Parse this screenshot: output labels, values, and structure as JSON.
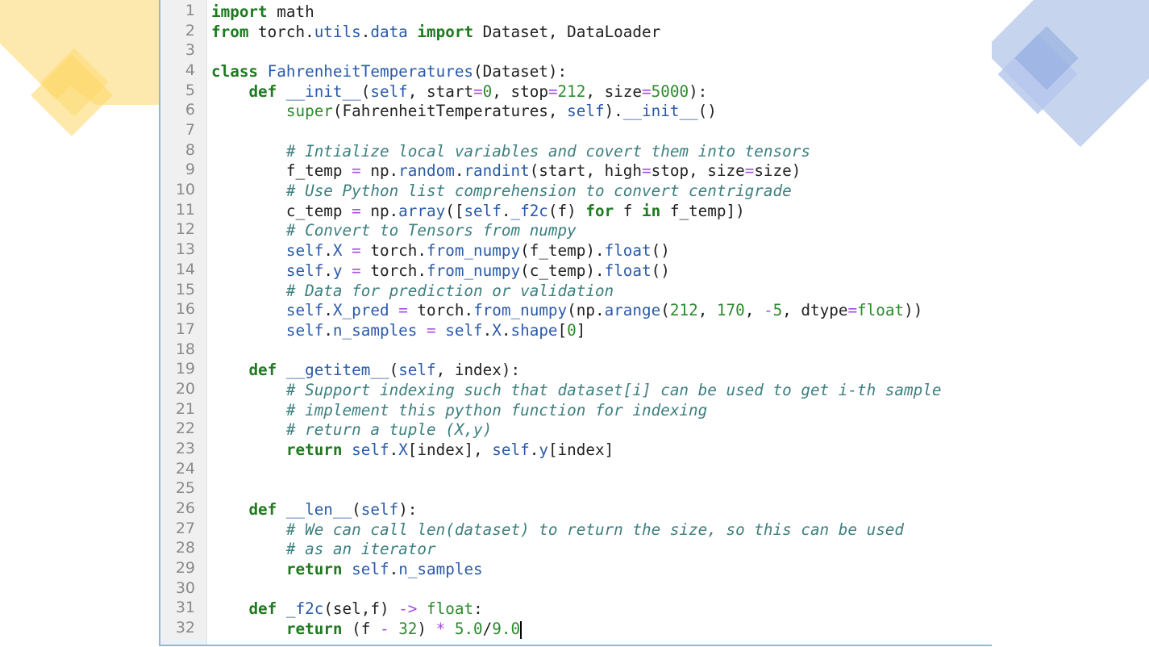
{
  "colors": {
    "keyword": "#1f7a1f",
    "name": "#2a5aa8",
    "number": "#2d8a2d",
    "operator": "#a64ce0",
    "comment": "#3d7f7f",
    "deco_yellow": "#fde7a8",
    "deco_blue": "#c5d3ee"
  },
  "editor": {
    "lines": [
      [
        [
          "k",
          "import"
        ],
        [
          "t",
          " math"
        ]
      ],
      [
        [
          "k",
          "from"
        ],
        [
          "t",
          " torch."
        ],
        [
          "n",
          "utils"
        ],
        [
          "t",
          "."
        ],
        [
          "n",
          "data"
        ],
        [
          "t",
          " "
        ],
        [
          "k",
          "import"
        ],
        [
          "t",
          " Dataset, DataLoader"
        ]
      ],
      [],
      [
        [
          "k",
          "class"
        ],
        [
          "t",
          " "
        ],
        [
          "n",
          "FahrenheitTemperatures"
        ],
        [
          "t",
          "(Dataset):"
        ]
      ],
      [
        [
          "t",
          "    "
        ],
        [
          "k",
          "def"
        ],
        [
          "t",
          " "
        ],
        [
          "n",
          "__init__"
        ],
        [
          "t",
          "("
        ],
        [
          "n",
          "self"
        ],
        [
          "t",
          ", start"
        ],
        [
          "o",
          "="
        ],
        [
          "m",
          "0"
        ],
        [
          "t",
          ", stop"
        ],
        [
          "o",
          "="
        ],
        [
          "m",
          "212"
        ],
        [
          "t",
          ", size"
        ],
        [
          "o",
          "="
        ],
        [
          "m",
          "5000"
        ],
        [
          "t",
          "):"
        ]
      ],
      [
        [
          "t",
          "        "
        ],
        [
          "b",
          "super"
        ],
        [
          "t",
          "(FahrenheitTemperatures, "
        ],
        [
          "n",
          "self"
        ],
        [
          "t",
          ")."
        ],
        [
          "n",
          "__init__"
        ],
        [
          "t",
          "()"
        ]
      ],
      [],
      [
        [
          "t",
          "        "
        ],
        [
          "c",
          "# Intialize local variables and covert them into tensors"
        ]
      ],
      [
        [
          "t",
          "        f_temp "
        ],
        [
          "o",
          "="
        ],
        [
          "t",
          " np."
        ],
        [
          "n",
          "random"
        ],
        [
          "t",
          "."
        ],
        [
          "n",
          "randint"
        ],
        [
          "t",
          "(start, high"
        ],
        [
          "o",
          "="
        ],
        [
          "t",
          "stop, size"
        ],
        [
          "o",
          "="
        ],
        [
          "t",
          "size)"
        ]
      ],
      [
        [
          "t",
          "        "
        ],
        [
          "c",
          "# Use Python list comprehension to convert centrigrade"
        ]
      ],
      [
        [
          "t",
          "        c_temp "
        ],
        [
          "o",
          "="
        ],
        [
          "t",
          " np."
        ],
        [
          "n",
          "array"
        ],
        [
          "t",
          "(["
        ],
        [
          "n",
          "self"
        ],
        [
          "t",
          "."
        ],
        [
          "n",
          "_f2c"
        ],
        [
          "t",
          "(f) "
        ],
        [
          "k",
          "for"
        ],
        [
          "t",
          " f "
        ],
        [
          "k",
          "in"
        ],
        [
          "t",
          " f_temp])"
        ]
      ],
      [
        [
          "t",
          "        "
        ],
        [
          "c",
          "# Convert to Tensors from numpy"
        ]
      ],
      [
        [
          "t",
          "        "
        ],
        [
          "n",
          "self"
        ],
        [
          "t",
          "."
        ],
        [
          "n",
          "X"
        ],
        [
          "t",
          " "
        ],
        [
          "o",
          "="
        ],
        [
          "t",
          " torch."
        ],
        [
          "n",
          "from_numpy"
        ],
        [
          "t",
          "(f_temp)."
        ],
        [
          "n",
          "float"
        ],
        [
          "t",
          "()"
        ]
      ],
      [
        [
          "t",
          "        "
        ],
        [
          "n",
          "self"
        ],
        [
          "t",
          "."
        ],
        [
          "n",
          "y"
        ],
        [
          "t",
          " "
        ],
        [
          "o",
          "="
        ],
        [
          "t",
          " torch."
        ],
        [
          "n",
          "from_numpy"
        ],
        [
          "t",
          "(c_temp)."
        ],
        [
          "n",
          "float"
        ],
        [
          "t",
          "()"
        ]
      ],
      [
        [
          "t",
          "        "
        ],
        [
          "c",
          "# Data for prediction or validation"
        ]
      ],
      [
        [
          "t",
          "        "
        ],
        [
          "n",
          "self"
        ],
        [
          "t",
          "."
        ],
        [
          "n",
          "X_pred"
        ],
        [
          "t",
          " "
        ],
        [
          "o",
          "="
        ],
        [
          "t",
          " torch."
        ],
        [
          "n",
          "from_numpy"
        ],
        [
          "t",
          "(np."
        ],
        [
          "n",
          "arange"
        ],
        [
          "t",
          "("
        ],
        [
          "m",
          "212"
        ],
        [
          "t",
          ", "
        ],
        [
          "m",
          "170"
        ],
        [
          "t",
          ", "
        ],
        [
          "o",
          "-"
        ],
        [
          "m",
          "5"
        ],
        [
          "t",
          ", dtype"
        ],
        [
          "o",
          "="
        ],
        [
          "b",
          "float"
        ],
        [
          "t",
          "))"
        ]
      ],
      [
        [
          "t",
          "        "
        ],
        [
          "n",
          "self"
        ],
        [
          "t",
          "."
        ],
        [
          "n",
          "n_samples"
        ],
        [
          "t",
          " "
        ],
        [
          "o",
          "="
        ],
        [
          "t",
          " "
        ],
        [
          "n",
          "self"
        ],
        [
          "t",
          "."
        ],
        [
          "n",
          "X"
        ],
        [
          "t",
          "."
        ],
        [
          "n",
          "shape"
        ],
        [
          "t",
          "["
        ],
        [
          "m",
          "0"
        ],
        [
          "t",
          "]"
        ]
      ],
      [],
      [
        [
          "t",
          "    "
        ],
        [
          "k",
          "def"
        ],
        [
          "t",
          " "
        ],
        [
          "n",
          "__getitem__"
        ],
        [
          "t",
          "("
        ],
        [
          "n",
          "self"
        ],
        [
          "t",
          ", index):"
        ]
      ],
      [
        [
          "t",
          "        "
        ],
        [
          "c",
          "# Support indexing such that dataset[i] can be used to get i-th sample"
        ]
      ],
      [
        [
          "t",
          "        "
        ],
        [
          "c",
          "# implement this python function for indexing"
        ]
      ],
      [
        [
          "t",
          "        "
        ],
        [
          "c",
          "# return a tuple (X,y)"
        ]
      ],
      [
        [
          "t",
          "        "
        ],
        [
          "k",
          "return"
        ],
        [
          "t",
          " "
        ],
        [
          "n",
          "self"
        ],
        [
          "t",
          "."
        ],
        [
          "n",
          "X"
        ],
        [
          "t",
          "[index], "
        ],
        [
          "n",
          "self"
        ],
        [
          "t",
          "."
        ],
        [
          "n",
          "y"
        ],
        [
          "t",
          "[index]"
        ]
      ],
      [],
      [],
      [
        [
          "t",
          "    "
        ],
        [
          "k",
          "def"
        ],
        [
          "t",
          " "
        ],
        [
          "n",
          "__len__"
        ],
        [
          "t",
          "("
        ],
        [
          "n",
          "self"
        ],
        [
          "t",
          "):"
        ]
      ],
      [
        [
          "t",
          "        "
        ],
        [
          "c",
          "# We can call len(dataset) to return the size, so this can be used"
        ]
      ],
      [
        [
          "t",
          "        "
        ],
        [
          "c",
          "# as an iterator"
        ]
      ],
      [
        [
          "t",
          "        "
        ],
        [
          "k",
          "return"
        ],
        [
          "t",
          " "
        ],
        [
          "n",
          "self"
        ],
        [
          "t",
          "."
        ],
        [
          "n",
          "n_samples"
        ]
      ],
      [],
      [
        [
          "t",
          "    "
        ],
        [
          "k",
          "def"
        ],
        [
          "t",
          " "
        ],
        [
          "n",
          "_f2c"
        ],
        [
          "t",
          "(sel,f) "
        ],
        [
          "o",
          "->"
        ],
        [
          "t",
          " "
        ],
        [
          "b",
          "float"
        ],
        [
          "t",
          ":"
        ]
      ],
      [
        [
          "t",
          "        "
        ],
        [
          "k",
          "return"
        ],
        [
          "t",
          " (f "
        ],
        [
          "o",
          "-"
        ],
        [
          "t",
          " "
        ],
        [
          "m",
          "32"
        ],
        [
          "t",
          ") "
        ],
        [
          "o",
          "*"
        ],
        [
          "t",
          " "
        ],
        [
          "m",
          "5.0"
        ],
        [
          "t",
          "/"
        ],
        [
          "m",
          "9.0"
        ]
      ]
    ]
  }
}
